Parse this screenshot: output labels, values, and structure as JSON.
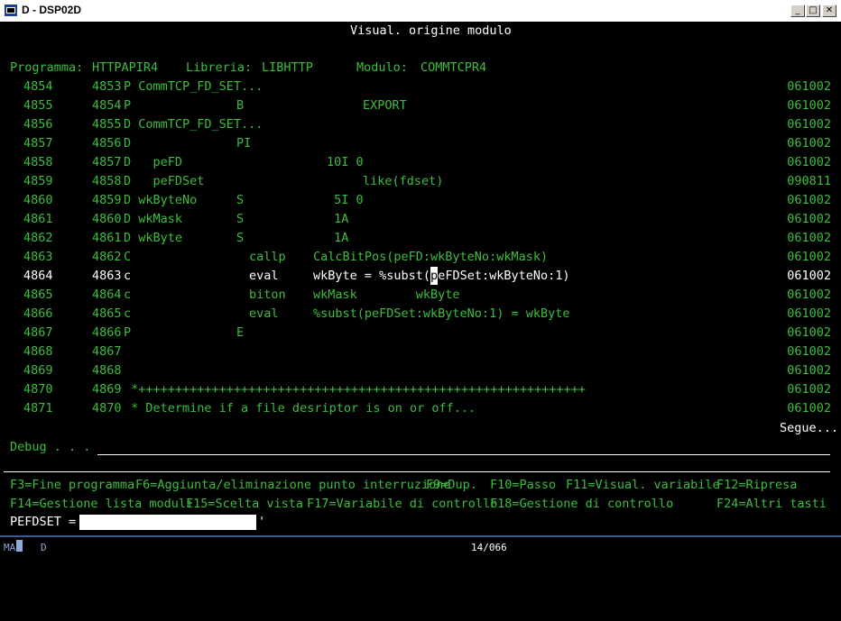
{
  "window": {
    "title": "D - DSP02D"
  },
  "header": {
    "title": "Visual. origine modulo"
  },
  "info": {
    "programma_label": "Programma:",
    "programma_value": "HTTPAPIR4",
    "libreria_label": "Libreria:",
    "libreria_value": "LIBHTTP",
    "modulo_label": "Modulo:",
    "modulo_value": "COMMTCPR4"
  },
  "lines": [
    {
      "num": "4854",
      "seq": "4853",
      "spec": "P CommTCP_FD_SET...",
      "c1": "",
      "c2": "",
      "c3": "",
      "date": "061002"
    },
    {
      "num": "4855",
      "seq": "4854",
      "spec": "P",
      "c1": "B",
      "c2": "",
      "c3": "EXPORT",
      "date": "061002"
    },
    {
      "num": "4856",
      "seq": "4855",
      "spec": "D CommTCP_FD_SET...",
      "c1": "",
      "c2": "",
      "c3": "",
      "date": "061002"
    },
    {
      "num": "4857",
      "seq": "4856",
      "spec": "D",
      "c1": "PI",
      "c2": "",
      "c3": "",
      "date": "061002"
    },
    {
      "num": "4858",
      "seq": "4857",
      "spec": "D   peFD",
      "c1": "",
      "c2": "10I 0",
      "c3": "",
      "date": "061002"
    },
    {
      "num": "4859",
      "seq": "4858",
      "spec": "D   peFDSet",
      "c1": "",
      "c2": "",
      "c3": "like(fdset)",
      "date": "090811"
    },
    {
      "num": "4860",
      "seq": "4859",
      "spec": "D wkByteNo",
      "c1": "S",
      "c2": " 5I 0",
      "c3": "",
      "date": "061002"
    },
    {
      "num": "4861",
      "seq": "4860",
      "spec": "D wkMask",
      "c1": "S",
      "c2": " 1A",
      "c3": "",
      "date": "061002"
    },
    {
      "num": "4862",
      "seq": "4861",
      "spec": "D wkByte",
      "c1": "S",
      "c2": " 1A",
      "c3": "",
      "date": "061002"
    },
    {
      "num": "4863",
      "seq": "4862",
      "spec": "C",
      "c1": "",
      "c2": "",
      "c3": "",
      "op": "callp",
      "expr": "CalcBitPos(peFD:wkByteNo:wkMask)",
      "date": "061002"
    },
    {
      "num": "4864",
      "seq": "4863",
      "spec": "c",
      "c1": "",
      "c2": "",
      "c3": "",
      "op": "eval",
      "expr": "wkByte = %subst(peFDSet:wkByteNo:1)",
      "date": "061002",
      "current": true
    },
    {
      "num": "4865",
      "seq": "4864",
      "spec": "c",
      "c1": "",
      "c2": "",
      "c3": "",
      "op": "biton",
      "expr": "wkMask        wkByte",
      "date": "061002"
    },
    {
      "num": "4866",
      "seq": "4865",
      "spec": "c",
      "c1": "",
      "c2": "",
      "c3": "",
      "op": "eval",
      "expr": "%subst(peFDSet:wkByteNo:1) = wkByte",
      "date": "061002"
    },
    {
      "num": "4867",
      "seq": "4866",
      "spec": "P",
      "c1": "E",
      "c2": "",
      "c3": "",
      "date": "061002"
    },
    {
      "num": "4868",
      "seq": "4867",
      "spec": "",
      "c1": "",
      "c2": "",
      "c3": "",
      "date": "061002"
    },
    {
      "num": "4869",
      "seq": "4868",
      "spec": "",
      "c1": "",
      "c2": "",
      "c3": "",
      "date": "061002"
    },
    {
      "num": "4870",
      "seq": "4869",
      "spec": " *+++++++++++++++++++++++++++++++++++++++++++++++++++++++++++++",
      "c1": "",
      "c2": "",
      "c3": "",
      "date": "061002"
    },
    {
      "num": "4871",
      "seq": "4870",
      "spec": " * Determine if a file desriptor is on or off...",
      "c1": "",
      "c2": "",
      "c3": "",
      "date": "061002"
    }
  ],
  "more": "Segue...",
  "debug": {
    "label": "Debug . . ."
  },
  "fkeys_row1": [
    {
      "key": "f3",
      "label": "F3=Fine programma"
    },
    {
      "key": "f6",
      "label": "F6=Aggiunta/eliminazione punto interruzione"
    },
    {
      "key": "f9",
      "label": "F9=Dup."
    },
    {
      "key": "f10",
      "label": "F10=Passo"
    },
    {
      "key": "f11",
      "label": "F11=Visual. variabile"
    },
    {
      "key": "f12",
      "label": "F12=Ripresa"
    }
  ],
  "fkeys_row2": [
    {
      "key": "f14",
      "label": "F14=Gestione lista moduli"
    },
    {
      "key": "f15",
      "label": "F15=Scelta vista"
    },
    {
      "key": "f17",
      "label": "F17=Variabile di controllo"
    },
    {
      "key": "f18",
      "label": "F18=Gestione di controllo"
    },
    {
      "key": "f24",
      "label": "F24=Altri tasti"
    }
  ],
  "result": {
    "label": "PEFDSET = '",
    "value": "",
    "close": "'"
  },
  "status": {
    "mode": "MA",
    "session": "D",
    "position": "14/066"
  },
  "colors": {
    "green": "#3dbd3d",
    "white": "#ffffff",
    "background": "#000000"
  }
}
